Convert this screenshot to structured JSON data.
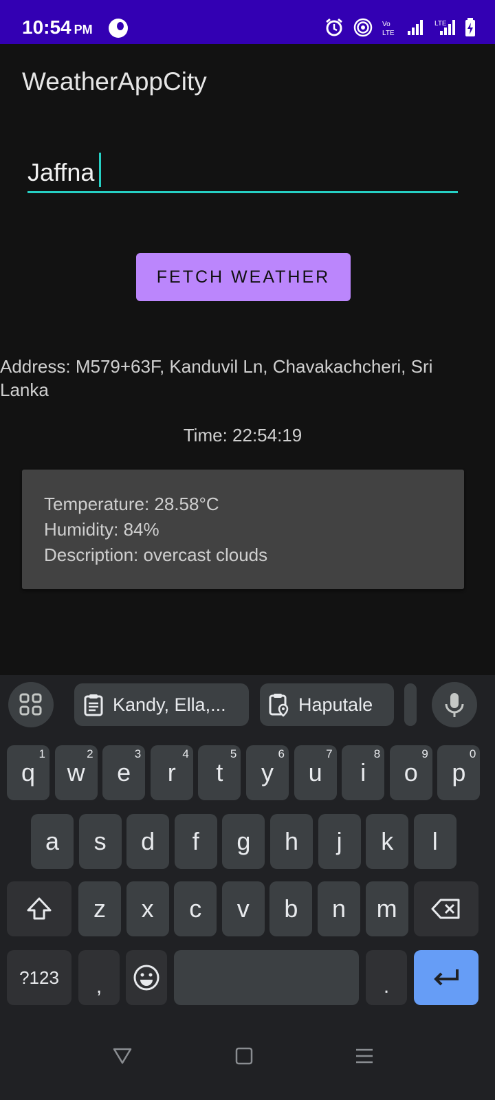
{
  "status_bar": {
    "time": "10:54",
    "ampm": "PM",
    "icons": [
      "app-notification-icon",
      "alarm-icon",
      "hotspot-icon",
      "volte-icon",
      "signal-icon",
      "lte-signal-icon",
      "battery-charging-icon"
    ]
  },
  "app": {
    "title": "WeatherAppCity",
    "city_input_value": "Jaffna",
    "fetch_button_label": "FETCH WEATHER",
    "address": "Address: M579+63F, Kanduvil Ln, Chavakachcheri, Sri Lanka",
    "time": "Time: 22:54:19",
    "weather": {
      "temperature": "Temperature: 28.58°C",
      "humidity": "Humidity: 84%",
      "description": "Description: overcast clouds"
    }
  },
  "keyboard": {
    "suggestions": [
      "Kandy, Ella,...",
      "Haputale"
    ],
    "row1": [
      {
        "k": "q",
        "h": "1"
      },
      {
        "k": "w",
        "h": "2"
      },
      {
        "k": "e",
        "h": "3"
      },
      {
        "k": "r",
        "h": "4"
      },
      {
        "k": "t",
        "h": "5"
      },
      {
        "k": "y",
        "h": "6"
      },
      {
        "k": "u",
        "h": "7"
      },
      {
        "k": "i",
        "h": "8"
      },
      {
        "k": "o",
        "h": "9"
      },
      {
        "k": "p",
        "h": "0"
      }
    ],
    "row2": [
      "a",
      "s",
      "d",
      "f",
      "g",
      "h",
      "j",
      "k",
      "l"
    ],
    "row3": [
      "z",
      "x",
      "c",
      "v",
      "b",
      "n",
      "m"
    ],
    "symbols_label": "?123",
    "comma": ",",
    "period": "."
  },
  "colors": {
    "accent": "#26d0c4",
    "button": "#bb86fc",
    "status_bar": "#3300b3",
    "enter_key": "#669df6"
  }
}
